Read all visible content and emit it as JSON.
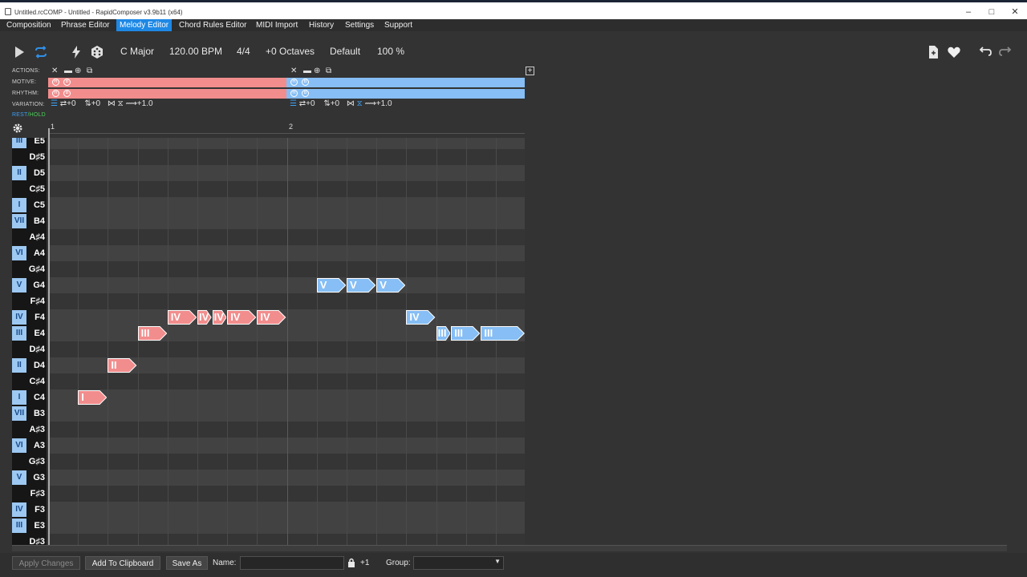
{
  "window": {
    "title": "Untitled.rcCOMP - Untitled - RapidComposer v3.9b11 (x64)",
    "controls": [
      "–",
      "□",
      "✕"
    ]
  },
  "menu": [
    "Composition",
    "Phrase Editor",
    "Melody Editor",
    "Chord Rules Editor",
    "MIDI Import",
    "History",
    "Settings",
    "Support"
  ],
  "menu_active": "Melody Editor",
  "toolbar": {
    "key": "C Major",
    "tempo": "120.00 BPM",
    "time_signature": "4/4",
    "octaves": "+0 Octaves",
    "preset": "Default",
    "zoom": "100 %"
  },
  "panel": {
    "actions_label": "ACTIONS:",
    "motive_label": "MOTIVE:",
    "rhythm_label": "RHYTHM:",
    "variation_label": "VARIATION:",
    "rest_label": "REST",
    "hold_label": "/HOLD",
    "var1": {
      "a": "⇄+0",
      "b": "⇅+0",
      "c": "⟿+1.0"
    },
    "var2": {
      "a": "⇄+0",
      "b": "⇅+0",
      "c": "⟿+1.0"
    },
    "mini_letter_a": "R",
    "mini_letter_b": "B"
  },
  "timeline": {
    "bars": [
      "1",
      "2"
    ]
  },
  "keys": [
    {
      "deg": "III",
      "note": "E5"
    },
    {
      "deg": "",
      "note": "D♯5"
    },
    {
      "deg": "II",
      "note": "D5"
    },
    {
      "deg": "",
      "note": "C♯5"
    },
    {
      "deg": "I",
      "note": "C5"
    },
    {
      "deg": "VII",
      "note": "B4"
    },
    {
      "deg": "",
      "note": "A♯4"
    },
    {
      "deg": "VI",
      "note": "A4"
    },
    {
      "deg": "",
      "note": "G♯4"
    },
    {
      "deg": "V",
      "note": "G4"
    },
    {
      "deg": "",
      "note": "F♯4"
    },
    {
      "deg": "IV",
      "note": "F4"
    },
    {
      "deg": "III",
      "note": "E4"
    },
    {
      "deg": "",
      "note": "D♯4"
    },
    {
      "deg": "II",
      "note": "D4"
    },
    {
      "deg": "",
      "note": "C♯4"
    },
    {
      "deg": "I",
      "note": "C4"
    },
    {
      "deg": "VII",
      "note": "B3"
    },
    {
      "deg": "",
      "note": "A♯3"
    },
    {
      "deg": "VI",
      "note": "A3"
    },
    {
      "deg": "",
      "note": "G♯3"
    },
    {
      "deg": "V",
      "note": "G3"
    },
    {
      "deg": "",
      "note": "F♯3"
    },
    {
      "deg": "IV",
      "note": "F3"
    },
    {
      "deg": "III",
      "note": "E3"
    },
    {
      "deg": "",
      "note": "D♯3"
    }
  ],
  "notes": [
    {
      "label": "I",
      "pitch": "C4",
      "beat": 1,
      "len": 1,
      "motive": 1
    },
    {
      "label": "II",
      "pitch": "D4",
      "beat": 2,
      "len": 1,
      "motive": 1
    },
    {
      "label": "III",
      "pitch": "E4",
      "beat": 3,
      "len": 1,
      "motive": 1
    },
    {
      "label": "IV",
      "pitch": "F4",
      "beat": 4,
      "len": 1,
      "motive": 1
    },
    {
      "label": "IV",
      "pitch": "F4",
      "beat": 5,
      "len": 0.5,
      "motive": 1
    },
    {
      "label": "IV",
      "pitch": "F4",
      "beat": 5.5,
      "len": 0.5,
      "motive": 1
    },
    {
      "label": "IV",
      "pitch": "F4",
      "beat": 6,
      "len": 1,
      "motive": 1
    },
    {
      "label": "IV",
      "pitch": "F4",
      "beat": 7,
      "len": 1,
      "motive": 1
    },
    {
      "label": "V",
      "pitch": "G4",
      "beat": 9,
      "len": 1,
      "motive": 2
    },
    {
      "label": "V",
      "pitch": "G4",
      "beat": 10,
      "len": 1,
      "motive": 2
    },
    {
      "label": "V",
      "pitch": "G4",
      "beat": 11,
      "len": 1,
      "motive": 2
    },
    {
      "label": "IV",
      "pitch": "F4",
      "beat": 12,
      "len": 1,
      "motive": 2
    },
    {
      "label": "III",
      "pitch": "E4",
      "beat": 13,
      "len": 0.5,
      "motive": 2
    },
    {
      "label": "III",
      "pitch": "E4",
      "beat": 13.5,
      "len": 1,
      "motive": 2
    },
    {
      "label": "III",
      "pitch": "E4",
      "beat": 14.5,
      "len": 1.5,
      "motive": 2
    }
  ],
  "colors": {
    "motive1": "#f28d8d",
    "motive2": "#86bef5",
    "accent": "#1e88e5"
  },
  "bottom": {
    "apply": "Apply Changes",
    "clipboard": "Add To Clipboard",
    "save_as": "Save As",
    "name_label": "Name:",
    "name_value": "",
    "plus": "+1",
    "group_label": "Group:",
    "group_value": ""
  }
}
